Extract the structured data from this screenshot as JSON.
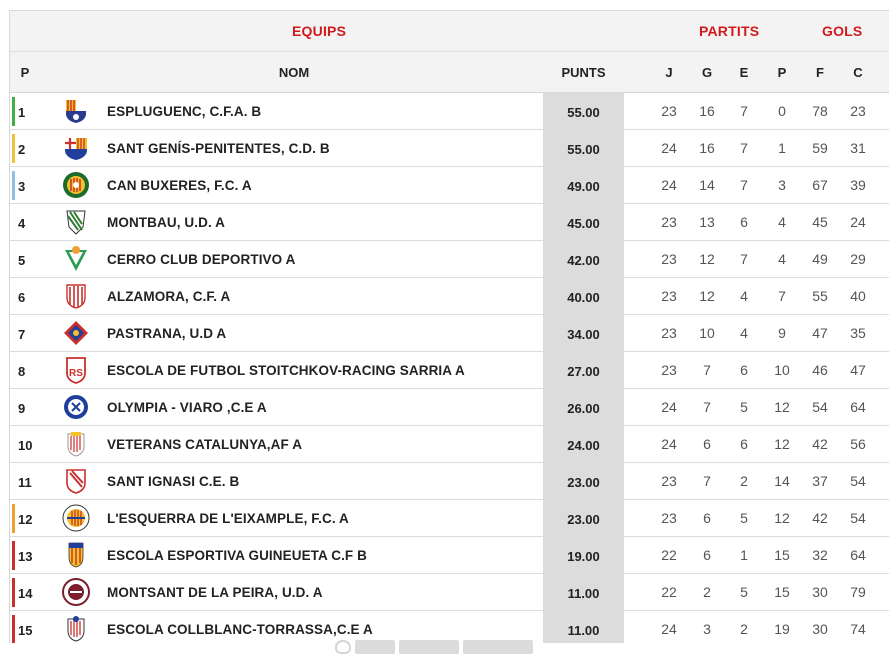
{
  "headers": {
    "equips": "EQUIPS",
    "partits": "PARTITS",
    "gols": "GOLS",
    "p": "P",
    "nom": "NOM",
    "punts": "PUNTS",
    "j": "J",
    "g": "G",
    "e": "E",
    "pp": "P",
    "f": "F",
    "c": "C"
  },
  "colors": {
    "header_red": "#d01b1b",
    "promotion_green": "#43b047",
    "promotion_yellow": "#f0c23a",
    "promotion_blue": "#8fc1e8",
    "playoff_orange": "#f0a030",
    "relegation_red": "#c9302c",
    "points_bg": "#dcdcdc"
  },
  "rows": [
    {
      "pos": "1",
      "name": "ESPLUGUENC, C.F.A. B",
      "pts": "55.00",
      "j": "23",
      "g": "16",
      "e": "7",
      "p": "0",
      "f": "78",
      "c": "23",
      "status": "promotion_green",
      "crest": "espluguenc-crest-icon"
    },
    {
      "pos": "2",
      "name": "SANT GENÍS-PENITENTES, C.D. B",
      "pts": "55.00",
      "j": "24",
      "g": "16",
      "e": "7",
      "p": "1",
      "f": "59",
      "c": "31",
      "status": "promotion_yellow",
      "crest": "sant-genis-crest-icon"
    },
    {
      "pos": "3",
      "name": "CAN BUXERES, F.C. A",
      "pts": "49.00",
      "j": "24",
      "g": "14",
      "e": "7",
      "p": "3",
      "f": "67",
      "c": "39",
      "status": "promotion_blue",
      "crest": "can-buxeres-crest-icon"
    },
    {
      "pos": "4",
      "name": "MONTBAU, U.D. A",
      "pts": "45.00",
      "j": "23",
      "g": "13",
      "e": "6",
      "p": "4",
      "f": "45",
      "c": "24",
      "status": "none",
      "crest": "montbau-crest-icon"
    },
    {
      "pos": "5",
      "name": "CERRO CLUB DEPORTIVO A",
      "pts": "42.00",
      "j": "23",
      "g": "12",
      "e": "7",
      "p": "4",
      "f": "49",
      "c": "29",
      "status": "none",
      "crest": "cerro-crest-icon"
    },
    {
      "pos": "6",
      "name": "ALZAMORA, C.F. A",
      "pts": "40.00",
      "j": "23",
      "g": "12",
      "e": "4",
      "p": "7",
      "f": "55",
      "c": "40",
      "status": "none",
      "crest": "alzamora-crest-icon"
    },
    {
      "pos": "7",
      "name": "PASTRANA, U.D A",
      "pts": "34.00",
      "j": "23",
      "g": "10",
      "e": "4",
      "p": "9",
      "f": "47",
      "c": "35",
      "status": "none",
      "crest": "pastrana-crest-icon"
    },
    {
      "pos": "8",
      "name": "ESCOLA DE FUTBOL STOITCHKOV-RACING SARRIA A",
      "pts": "27.00",
      "j": "23",
      "g": "7",
      "e": "6",
      "p": "10",
      "f": "46",
      "c": "47",
      "status": "none",
      "crest": "racing-sarria-crest-icon"
    },
    {
      "pos": "9",
      "name": "OLYMPIA - VIARO ,C.E A",
      "pts": "26.00",
      "j": "24",
      "g": "7",
      "e": "5",
      "p": "12",
      "f": "54",
      "c": "64",
      "status": "none",
      "crest": "olympia-viaro-crest-icon"
    },
    {
      "pos": "10",
      "name": "VETERANS CATALUNYA,AF A",
      "pts": "24.00",
      "j": "24",
      "g": "6",
      "e": "6",
      "p": "12",
      "f": "42",
      "c": "56",
      "status": "none",
      "crest": "veterans-crest-icon"
    },
    {
      "pos": "11",
      "name": "SANT IGNASI C.E. B",
      "pts": "23.00",
      "j": "23",
      "g": "7",
      "e": "2",
      "p": "14",
      "f": "37",
      "c": "54",
      "status": "none",
      "crest": "sant-ignasi-crest-icon"
    },
    {
      "pos": "12",
      "name": "L'ESQUERRA DE L'EIXAMPLE, F.C. A",
      "pts": "23.00",
      "j": "23",
      "g": "6",
      "e": "5",
      "p": "12",
      "f": "42",
      "c": "54",
      "status": "playoff_orange",
      "crest": "esquerra-eixample-crest-icon"
    },
    {
      "pos": "13",
      "name": "ESCOLA ESPORTIVA GUINEUETA C.F B",
      "pts": "19.00",
      "j": "22",
      "g": "6",
      "e": "1",
      "p": "15",
      "f": "32",
      "c": "64",
      "status": "relegation_red",
      "crest": "guineueta-crest-icon"
    },
    {
      "pos": "14",
      "name": "MONTSANT DE LA PEIRA, U.D. A",
      "pts": "11.00",
      "j": "22",
      "g": "2",
      "e": "5",
      "p": "15",
      "f": "30",
      "c": "79",
      "status": "relegation_red",
      "crest": "montsant-crest-icon"
    },
    {
      "pos": "15",
      "name": "ESCOLA COLLBLANC-TORRASSA,C.E A",
      "pts": "11.00",
      "j": "24",
      "g": "3",
      "e": "2",
      "p": "19",
      "f": "30",
      "c": "74",
      "status": "relegation_red",
      "crest": "collblanc-crest-icon"
    }
  ]
}
